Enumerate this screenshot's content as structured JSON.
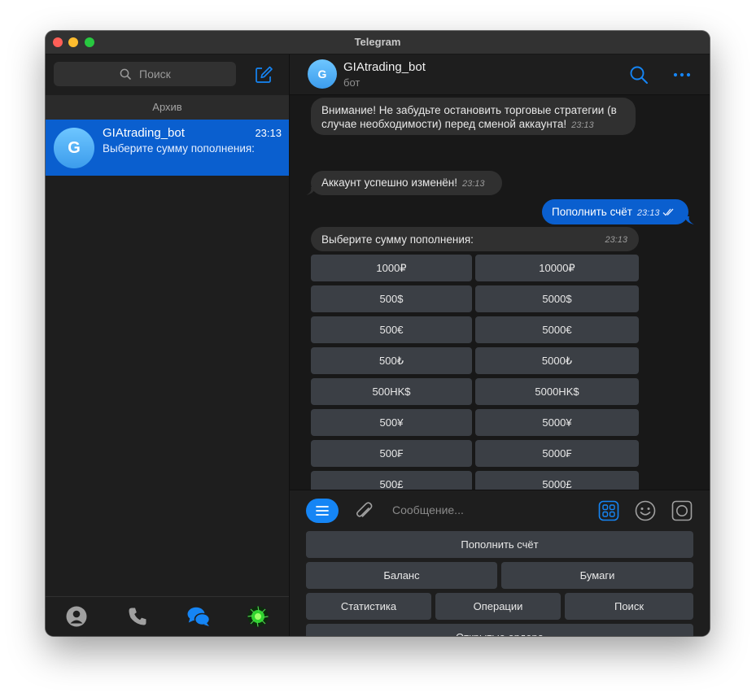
{
  "window": {
    "title": "Telegram"
  },
  "sidebar": {
    "search_placeholder": "Поиск",
    "archive_label": "Архив",
    "chats": [
      {
        "avatar_letter": "G",
        "name": "GIAtrading_bot",
        "time": "23:13",
        "preview": "Выберите сумму пополнения:"
      }
    ],
    "tabs": [
      "contacts-icon",
      "calls-icon",
      "chats-icon",
      "settings-icon"
    ]
  },
  "chat": {
    "header": {
      "avatar_letter": "G",
      "name": "GIAtrading_bot",
      "subtitle": "бот"
    },
    "messages": [
      {
        "direction": "in",
        "text": "Внимание! Не забудьте остановить торговые стратегии (в случае необходимости) перед сменой аккаунта!",
        "time": "23:13"
      },
      {
        "direction": "in",
        "text": "Аккаунт успешно изменён!",
        "time": "23:13"
      },
      {
        "direction": "out",
        "text": "Пополнить счёт",
        "time": "23:13",
        "status": "read"
      },
      {
        "direction": "in",
        "text": "Выберите сумму пополнения:",
        "time": "23:13"
      }
    ],
    "inline_keyboard": [
      [
        "1000₽",
        "10000₽"
      ],
      [
        "500$",
        "5000$"
      ],
      [
        "500€",
        "5000€"
      ],
      [
        "500₺",
        "5000₺"
      ],
      [
        "500HK$",
        "5000HK$"
      ],
      [
        "500¥",
        "5000¥"
      ],
      [
        "500₣",
        "5000₣"
      ],
      [
        "500£",
        "5000£"
      ]
    ]
  },
  "composer": {
    "placeholder": "Сообщение...",
    "reply_keyboard": [
      [
        "Пополнить счёт"
      ],
      [
        "Баланс",
        "Бумаги"
      ],
      [
        "Статистика",
        "Операции",
        "Поиск"
      ],
      [
        "Открытые ордера"
      ]
    ]
  },
  "colors": {
    "accent": "#0a5fcf",
    "button_blue": "#1585f5",
    "bubble_in": "#303030",
    "keyboard_button": "#3b3f45"
  }
}
